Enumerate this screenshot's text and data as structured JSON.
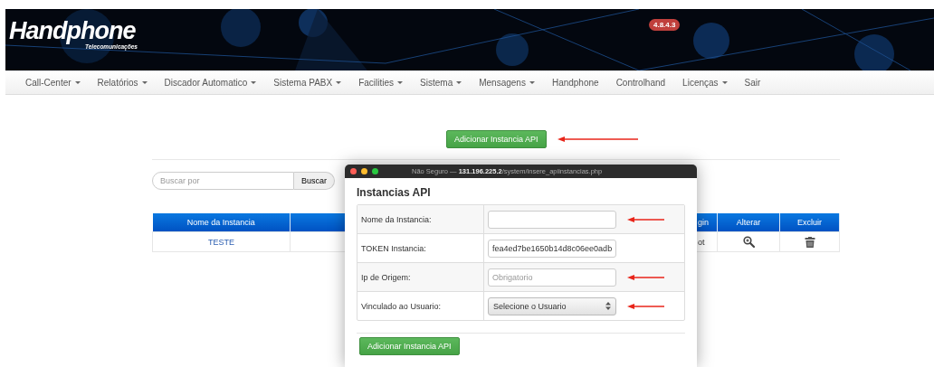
{
  "header": {
    "logo": {
      "name": "Handphone",
      "tagline": "Telecomunicações"
    },
    "version": "4.8.4.3"
  },
  "nav": [
    {
      "label": "Call-Center",
      "dropdown": true
    },
    {
      "label": "Relatórios",
      "dropdown": true
    },
    {
      "label": "Discador Automatico",
      "dropdown": true
    },
    {
      "label": "Sistema PABX",
      "dropdown": true
    },
    {
      "label": "Facilities",
      "dropdown": true
    },
    {
      "label": "Sistema",
      "dropdown": true
    },
    {
      "label": "Mensagens",
      "dropdown": true
    },
    {
      "label": "Handphone",
      "dropdown": false
    },
    {
      "label": "Controlhand",
      "dropdown": false
    },
    {
      "label": "Licenças",
      "dropdown": true
    },
    {
      "label": "Sair",
      "dropdown": false
    }
  ],
  "add_button": {
    "label": "Adicionar Instancia API",
    "marked": true
  },
  "search": {
    "placeholder": "Buscar por",
    "button": "Buscar"
  },
  "table": {
    "columns": [
      {
        "label": "Nome da Instancia"
      },
      {
        "label": "gin"
      },
      {
        "label": "Alterar"
      },
      {
        "label": "Excluir"
      }
    ],
    "rows": [
      {
        "name": "TESTE",
        "column_3": "ot"
      }
    ]
  },
  "popup": {
    "title": "Não Seguro — **131.196.225.2**/system/insere_apiinstancias.php",
    "heading": "Instancias API",
    "fields": [
      {
        "kind": "text",
        "label": "Nome da Instancia:",
        "marked": true
      },
      {
        "kind": "text",
        "label": "TOKEN Instancia:",
        "value": "fea4ed7be1650b14d8c06ee0adb",
        "marked": false
      },
      {
        "kind": "text",
        "label": "Ip de Origem:",
        "placeholder": "Obrigatorio",
        "marked": true
      },
      {
        "kind": "select",
        "label": "Vinculado ao Usuario:",
        "value": "Selecione o Usuario",
        "marked": true
      }
    ],
    "submit": "Adicionar Instancia API"
  }
}
